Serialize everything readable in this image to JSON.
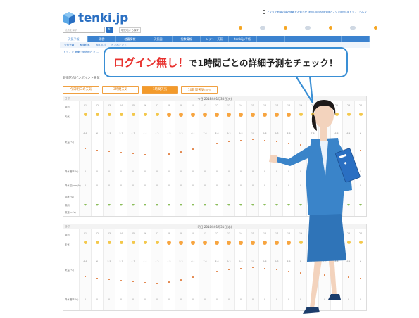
{
  "header": {
    "logo_text": "tenki.jp",
    "app_promo": "アプリで雨雲の接近情報をお知らせ tenki.jpのAndroidアプリ / tenki.jpトップ / ヘルプ"
  },
  "search": {
    "placeholder": "地点を探す",
    "current_location": "現在地から探す"
  },
  "nav": {
    "items": [
      "天気予報",
      "雨雲",
      "地震情報",
      "天気図",
      "指数情報",
      "レジャー天気",
      "tenki.jp手帳",
      "",
      "",
      "",
      ""
    ],
    "active_index": 0
  },
  "subnav": [
    "天気予報",
    "都道府県",
    "市区町村",
    "ピンポイント"
  ],
  "breadcrumb": "トップ > 関東・甲信地方 > ...",
  "panel": {
    "title": "新宿区のピンポイント天気",
    "tabs": [
      {
        "label": "今日明日の天気"
      },
      {
        "label": "3時間天気"
      },
      {
        "label": "1時間天気",
        "active": true
      },
      {
        "label": "10日間天気",
        "badge": "(10日)"
      }
    ]
  },
  "table1": {
    "date": "今日 2018年01月30日(火)",
    "hours": [
      "01",
      "02",
      "03",
      "04",
      "05",
      "06",
      "07",
      "08",
      "09",
      "10",
      "11",
      "12",
      "13",
      "14",
      "15",
      "16",
      "17",
      "18",
      "19",
      "20",
      "21",
      "22",
      "23",
      "24"
    ],
    "row_labels": [
      "日付",
      "時刻",
      "天気",
      "気温(℃)",
      "降水確率(%)",
      "降水量(mm/h)",
      "湿度(%)",
      "風向",
      "風速(m/s)"
    ],
    "weather": [
      "moon",
      "moon",
      "moon",
      "moon",
      "moon",
      "moon",
      "moon",
      "sun",
      "sun",
      "sun",
      "sun",
      "sun",
      "sun",
      "sun",
      "sun",
      "sun",
      "sun",
      "sun",
      "moon",
      "moon",
      "moon",
      "moon",
      "moon",
      "moon"
    ],
    "temps": [
      6.6,
      6.0,
      5.5,
      5.1,
      4.7,
      4.4,
      4.2,
      4.5,
      5.3,
      6.4,
      7.6,
      8.6,
      9.3,
      9.8,
      10.0,
      9.8,
      9.3,
      8.6,
      8.0,
      7.6,
      7.2,
      6.8,
      6.4,
      6.0
    ],
    "precip": [
      "0",
      "0",
      "0",
      "0",
      "0",
      "0",
      "0",
      "0",
      "0",
      "0",
      "0",
      "0",
      "0",
      "0",
      "0",
      "0",
      "0",
      "0",
      "0",
      "0",
      "0",
      "0",
      "0",
      "0"
    ]
  },
  "table2": {
    "date": "明日 2018年01月31日(水)",
    "weather": [
      "moon",
      "moon",
      "moon",
      "moon",
      "moon",
      "moon",
      "moon",
      "sun",
      "sun",
      "sun",
      "sun",
      "sun",
      "sun",
      "sun",
      "sun",
      "sun",
      "sun",
      "sun",
      "moon",
      "moon",
      "moon",
      "moon",
      "moon",
      "moon"
    ]
  },
  "bubble": {
    "red_text": "ログイン無し！",
    "dark_text": "で1時間ごとの詳細予測をチェック！"
  },
  "colors": {
    "brand_blue": "#2a6fc2",
    "bubble_border": "#3a8fd5",
    "accent_orange": "#f39a2b",
    "red": "#e8312e",
    "suit": "#2f74b8"
  }
}
